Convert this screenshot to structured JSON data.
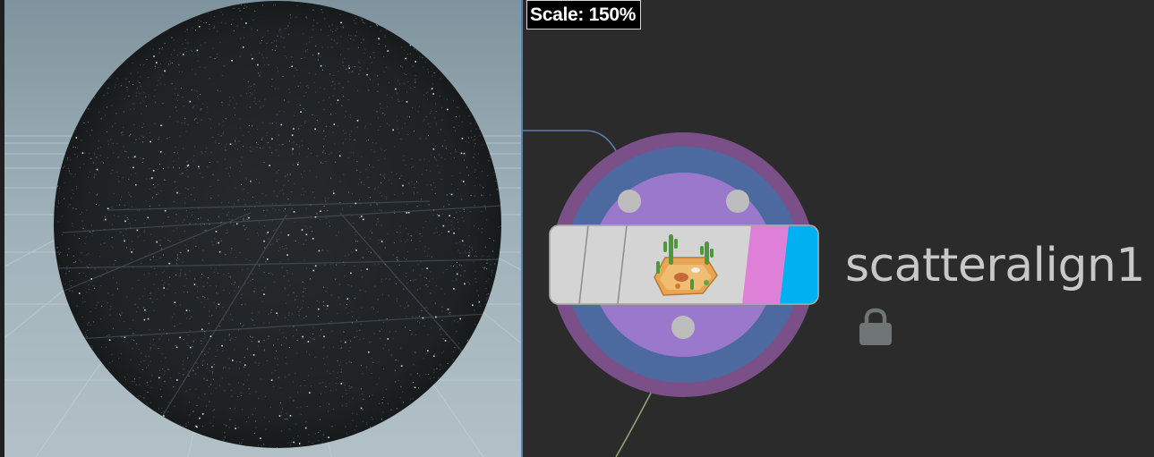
{
  "viewport": {
    "panel": "scene-viewport",
    "object": "point-sphere"
  },
  "network_editor": {
    "scale_label": "Scale: 150%",
    "node": {
      "name": "scatteralign1",
      "icon": "desert-cactus-icon",
      "locked": true,
      "lock_icon": "padlock-icon",
      "colors": {
        "outer_ring": "#7b4f87",
        "middle_ring": "#4d6aa0",
        "inner_disc": "#9a78cc",
        "body": "#d4d4d4",
        "display_flag": "#de7fd8",
        "render_flag": "#00b0f0",
        "connector": "#bdbdbd"
      }
    },
    "wires": {
      "input_color": "#5b82b0",
      "output_color": "#8fa374"
    }
  }
}
